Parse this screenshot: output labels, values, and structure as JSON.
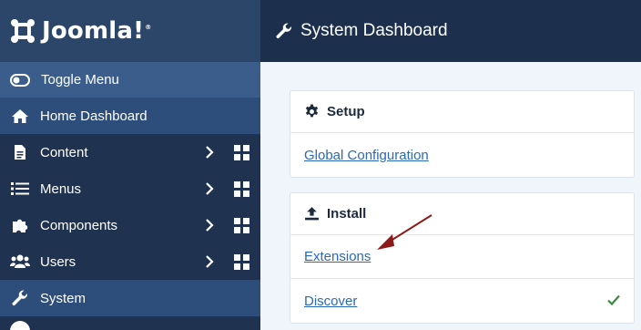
{
  "brand": {
    "name": "Joomla!",
    "reg": "®"
  },
  "sidebar": {
    "toggle_label": "Toggle Menu",
    "items": [
      {
        "label": "Home Dashboard",
        "icon": "home-icon"
      },
      {
        "label": "Content",
        "icon": "file-icon"
      },
      {
        "label": "Menus",
        "icon": "list-icon"
      },
      {
        "label": "Components",
        "icon": "puzzle-icon"
      },
      {
        "label": "Users",
        "icon": "users-icon"
      },
      {
        "label": "System",
        "icon": "wrench-icon"
      }
    ]
  },
  "header": {
    "title": "System Dashboard",
    "icon": "wrench-icon"
  },
  "setup": {
    "title": "Setup",
    "links": [
      "Global Configuration"
    ]
  },
  "install": {
    "title": "Install",
    "links": [
      "Extensions",
      "Discover"
    ]
  },
  "colors": {
    "sidebar": "#1f3250",
    "active": "#2d4d7a",
    "link": "#2a69b8",
    "check": "#3b8a3e",
    "annotation_arrow": "#8b1a1a"
  }
}
